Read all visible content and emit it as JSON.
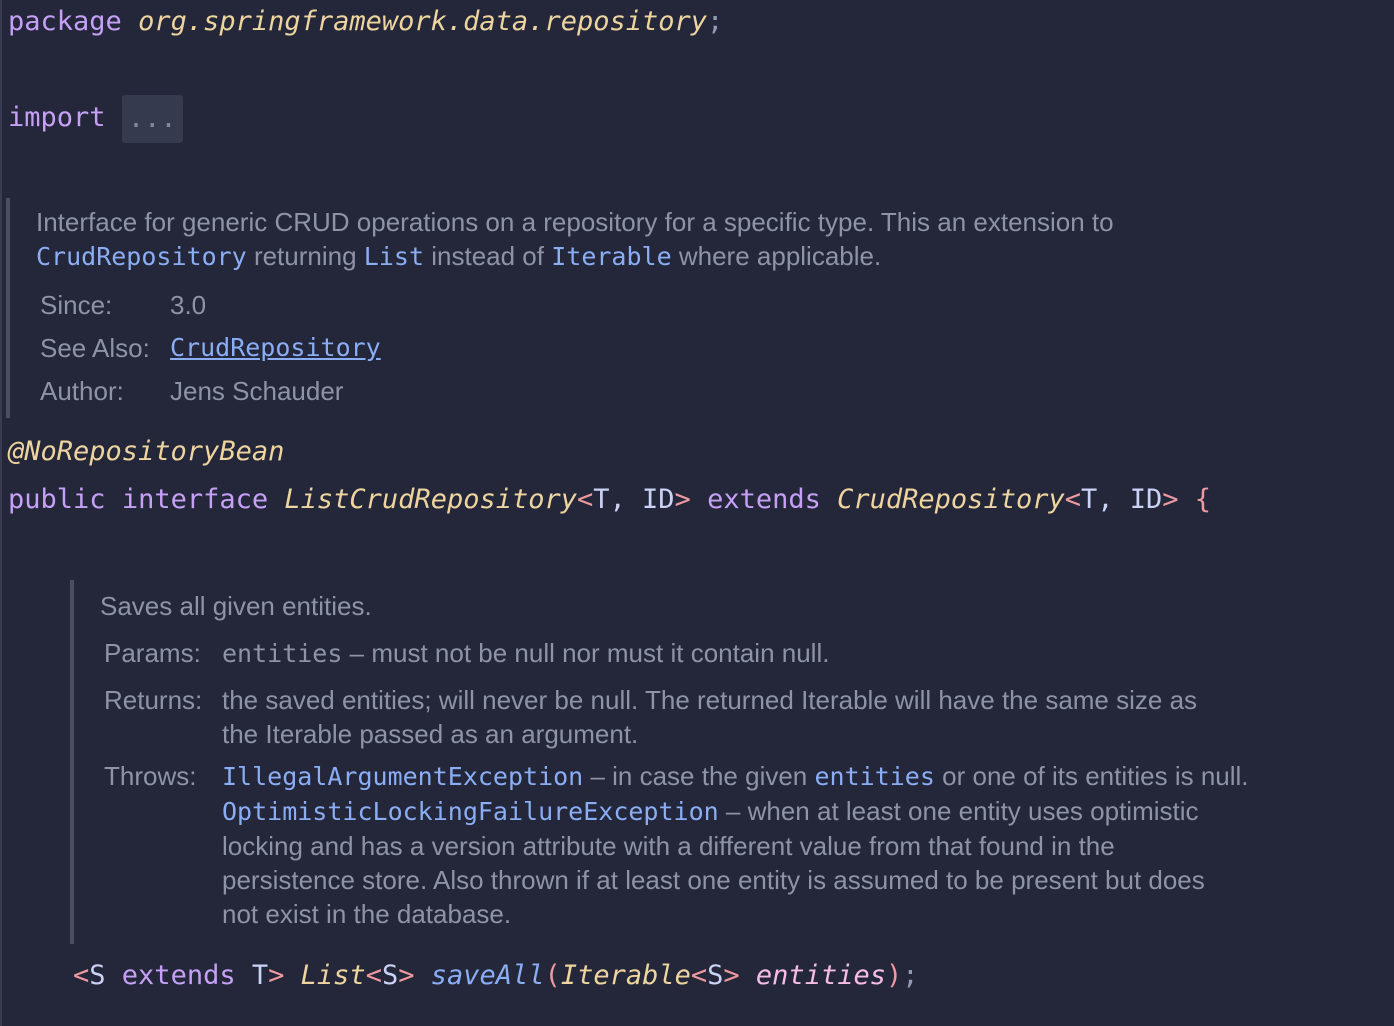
{
  "editor": {
    "line1": {
      "keyword": "package",
      "name": "org.springframework.data.repository",
      "semi": ";"
    },
    "line2": {
      "keyword": "import",
      "fold": "..."
    },
    "interface_doc": {
      "description_1": "Interface for generic CRUD operations on a repository for a specific type. This an extension to",
      "ref_crud": "CrudRepository",
      "mid_1": " returning ",
      "ref_list": "List",
      "mid_2": " instead of ",
      "ref_iterable": "Iterable",
      "mid_3": " where applicable.",
      "since_label": "Since:",
      "since_value": "3.0",
      "see_also_label": "See Also:",
      "see_also_value": "CrudRepository",
      "author_label": "Author:",
      "author_value": "Jens Schauder"
    },
    "annotation": "@NoRepositoryBean",
    "decl": {
      "public": "public",
      "interface": "interface",
      "name": "ListCrudRepository",
      "lt1": "<",
      "generics1": "T, ID",
      "gt1": ">",
      "extends": "extends",
      "super": "CrudRepository",
      "lt2": "<",
      "generics2": "T, ID",
      "gt2": ">",
      "brace": "{"
    },
    "method_doc": {
      "summary": "Saves all given entities.",
      "params_label": "Params:",
      "param_name": "entities",
      "param_desc": " – must not be null nor must it contain null.",
      "returns_label": "Returns:",
      "returns_line1": "the saved entities; will never be null. The returned Iterable will have the same size as",
      "returns_line2": "the Iterable passed as an argument.",
      "throws_label": "Throws:",
      "ex1": "IllegalArgumentException",
      "ex1_desc_a": " – in case the given ",
      "ex1_ref": "entities",
      "ex1_desc_b": " or one of its entities is null.",
      "ex2": "OptimisticLockingFailureException",
      "ex2_desc_1": " – when at least one entity uses optimistic",
      "ex2_desc_2": "locking and has a version attribute with a different value from that found in the",
      "ex2_desc_3": "persistence store. Also thrown if at least one entity is assumed to be present but does",
      "ex2_desc_4": "not exist in the database."
    },
    "method": {
      "lt": "<",
      "type_param": "S",
      "extends": "extends",
      "bound": "T",
      "gt": ">",
      "return_type": "List",
      "ret_lt": "<",
      "ret_param": "S",
      "ret_gt": ">",
      "name": "saveAll",
      "open_paren": "(",
      "arg_type": "Iterable",
      "arg_lt": "<",
      "arg_param": "S",
      "arg_gt": ">",
      "arg_name": "entities",
      "close_paren": ")",
      "semi": ";"
    }
  }
}
